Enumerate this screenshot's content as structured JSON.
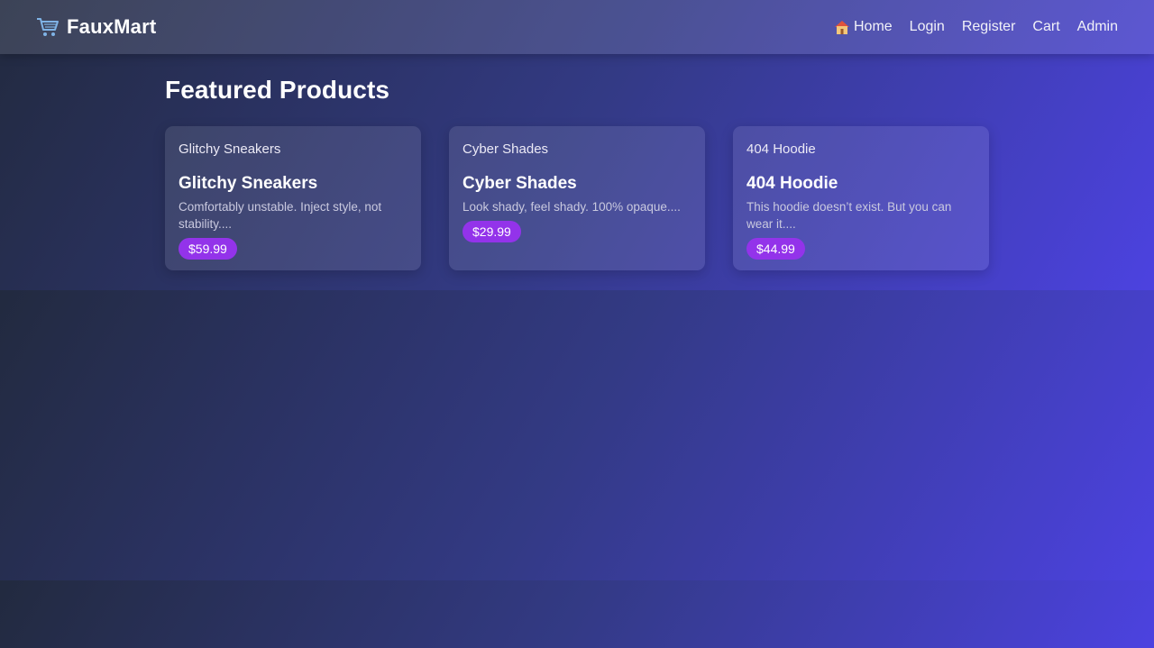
{
  "brand": {
    "name": "FauxMart",
    "icon": "shopping-cart-icon"
  },
  "nav": {
    "items": [
      {
        "label": "Home",
        "icon": "house-icon"
      },
      {
        "label": "Login"
      },
      {
        "label": "Register"
      },
      {
        "label": "Cart"
      },
      {
        "label": "Admin"
      }
    ]
  },
  "page": {
    "title": "Featured Products"
  },
  "products": [
    {
      "image_alt": "Glitchy Sneakers",
      "name": "Glitchy Sneakers",
      "description": "Comfortably unstable. Inject style, not stability....",
      "price": "$59.99"
    },
    {
      "image_alt": "Cyber Shades",
      "name": "Cyber Shades",
      "description": "Look shady, feel shady. 100% opaque....",
      "price": "$29.99"
    },
    {
      "image_alt": "404 Hoodie",
      "name": "404 Hoodie",
      "description": "This hoodie doesn’t exist. But you can wear it....",
      "price": "$44.99"
    }
  ],
  "colors": {
    "accent": "#9333ea",
    "gradient_start": "#222a3f",
    "gradient_end": "#4c42e0"
  }
}
